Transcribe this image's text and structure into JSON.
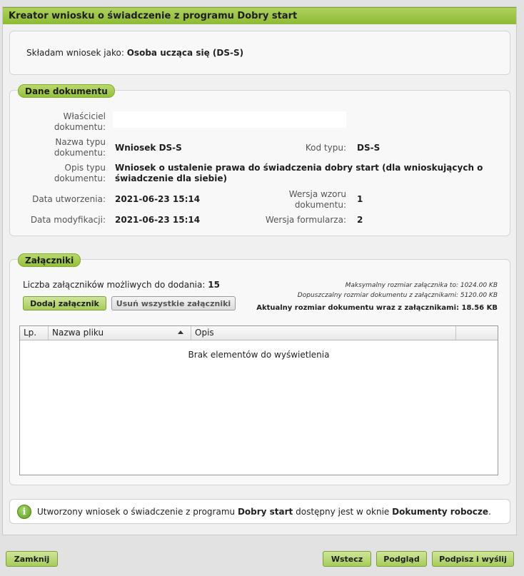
{
  "window": {
    "title": "Kreator wniosku o świadczenie z programu Dobry start"
  },
  "applicant": {
    "label": "Składam wniosek jako:",
    "value": "Osoba ucząca się (DS-S)"
  },
  "document": {
    "legend": "Dane dokumentu",
    "owner_label_1": "Właściciel",
    "owner_label_2": "dokumentu:",
    "owner_value": "",
    "type_name_label_1": "Nazwa typu",
    "type_name_label_2": "dokumentu:",
    "type_name_value": "Wniosek DS-S",
    "type_code_label": "Kod typu:",
    "type_code_value": "DS-S",
    "type_desc_label_1": "Opis typu",
    "type_desc_label_2": "dokumentu:",
    "type_desc_value_1": "Wniosek o ustalenie prawa do świadczenia dobry start (dla wnioskujących o",
    "type_desc_value_2": "świadczenie dla siebie)",
    "created_label": "Data utworzenia:",
    "created_value": "2021-06-23 15:14",
    "template_version_label_1": "Wersja wzoru",
    "template_version_label_2": "dokumentu:",
    "template_version_value": "1",
    "modified_label": "Data modyfikacji:",
    "modified_value": "2021-06-23 15:14",
    "form_version_label": "Wersja formularza:",
    "form_version_value": "2"
  },
  "attachments": {
    "legend": "Załączniki",
    "count_label": "Liczba załączników możliwych do dodania:",
    "count_value": "15",
    "max_size_text": "Maksymalny rozmiar załącznika to: 1024.00 KB",
    "allowed_size_text": "Dopuszczalny rozmiar dokumentu z załącznikami: 5120.00 KB",
    "current_size_text": "Aktualny rozmiar dokumentu wraz z załącznikami: 18.56 KB",
    "add_button": "Dodaj załącznik",
    "remove_all_button": "Usuń wszystkie załączniki",
    "columns": [
      "Lp.",
      "Nazwa pliku",
      "Opis"
    ],
    "empty_message": "Brak elementów do wyświetlenia"
  },
  "notice": {
    "text_1": "Utworzony wniosek o świadczenie z programu",
    "bold_1": "Dobry start",
    "text_2": "dostępny jest w oknie",
    "bold_2": "Dokumenty robocze",
    "text_3": "."
  },
  "footer": {
    "close_button": "Zamknij",
    "back_button": "Wstecz",
    "preview_button": "Podgląd",
    "sign_send_button": "Podpisz i wyślij"
  }
}
